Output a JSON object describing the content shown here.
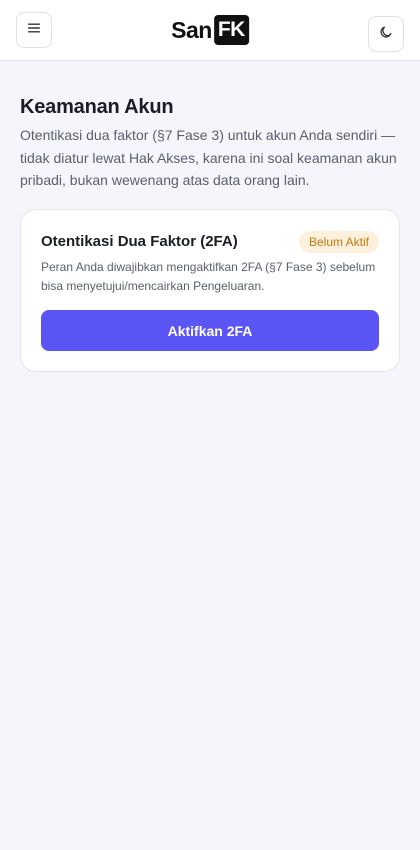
{
  "header": {
    "menu_icon": "hamburger-menu-icon",
    "logo_left": "San",
    "logo_right": "FK",
    "theme_icon": "moon-icon"
  },
  "page": {
    "title": "Keamanan Akun",
    "description": "Otentikasi dua faktor (§7 Fase 3) untuk akun Anda sendiri — tidak diatur lewat Hak Akses, karena ini soal keamanan akun pribadi, bukan wewenang atas data orang lain."
  },
  "card": {
    "title": "Otentikasi Dua Faktor (2FA)",
    "status_badge": "Belum Aktif",
    "description": "Peran Anda diwajibkan mengaktifkan 2FA (§7 Fase 3) sebelum bisa menyetujui/mencairkan Pengeluaran.",
    "button_label": "Aktifkan 2FA"
  },
  "colors": {
    "accent": "#5b55f6",
    "badge_bg": "#fdf0dc",
    "badge_text": "#c27a10",
    "page_bg": "#f5f6fb"
  }
}
